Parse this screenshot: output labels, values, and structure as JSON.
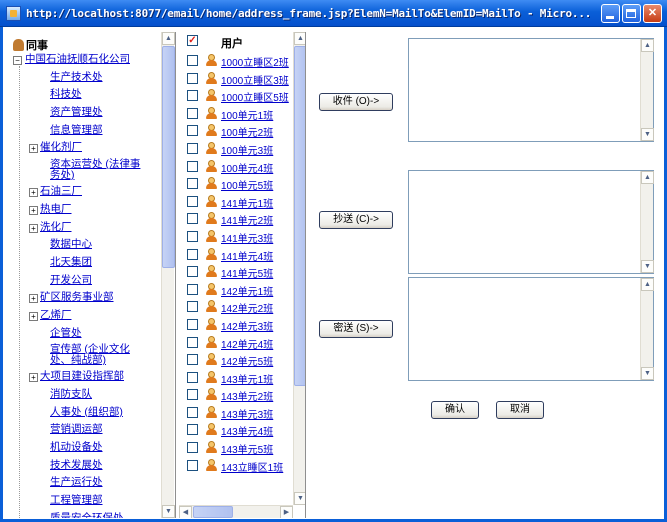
{
  "window": {
    "title": "http://localhost:8077/email/home/address_frame.jsp?ElemN=MailTo&ElemID=MailTo - Micro..."
  },
  "tree": {
    "header": "同事",
    "root": "中国石油抚顺石化公司",
    "items": [
      {
        "label": "生产技术处",
        "expandable": false
      },
      {
        "label": "科技处",
        "expandable": false
      },
      {
        "label": "资产管理处",
        "expandable": false
      },
      {
        "label": "信息管理部",
        "expandable": false
      },
      {
        "label": "催化剂厂",
        "expandable": true
      },
      {
        "label": "资本运营处 (法律事务处)",
        "expandable": false
      },
      {
        "label": "石油三厂",
        "expandable": true
      },
      {
        "label": "热电厂",
        "expandable": true
      },
      {
        "label": "洗化厂",
        "expandable": true
      },
      {
        "label": "数据中心",
        "expandable": false
      },
      {
        "label": "北天集团",
        "expandable": false
      },
      {
        "label": "开发公司",
        "expandable": false
      },
      {
        "label": "矿区服务事业部",
        "expandable": true
      },
      {
        "label": "乙烯厂",
        "expandable": true
      },
      {
        "label": "企管处",
        "expandable": false
      },
      {
        "label": "宣传部 (企业文化处、纯战部)",
        "expandable": false
      },
      {
        "label": "大项目建设指挥部",
        "expandable": true
      },
      {
        "label": "消防支队",
        "expandable": false
      },
      {
        "label": "人事处 (组织部)",
        "expandable": false
      },
      {
        "label": "营销调运部",
        "expandable": false
      },
      {
        "label": "机动设备处",
        "expandable": false
      },
      {
        "label": "技术发展处",
        "expandable": false
      },
      {
        "label": "生产运行处",
        "expandable": false
      },
      {
        "label": "工程管理部",
        "expandable": false
      },
      {
        "label": "质量安全环保处",
        "expandable": false
      }
    ]
  },
  "users": {
    "header": "用户",
    "items": [
      "1000立睡区2班",
      "1000立睡区3班",
      "1000立睡区5班",
      "100单元1班",
      "100单元2班",
      "100单元3班",
      "100单元4班",
      "100单元5班",
      "141单元1班",
      "141单元2班",
      "141单元3班",
      "141单元4班",
      "141单元5班",
      "142单元1班",
      "142单元2班",
      "142单元3班",
      "142单元4班",
      "142单元5班",
      "143单元1班",
      "143单元2班",
      "143单元3班",
      "143单元4班",
      "143单元5班",
      "143立睡区1班"
    ]
  },
  "recipients": {
    "to_label": "收件 (O)->",
    "cc_label": "抄送 (C)->",
    "bcc_label": "密送 (S)->",
    "to_value": "",
    "cc_value": "",
    "bcc_value": ""
  },
  "actions": {
    "ok_label": "确认",
    "cancel_label": "取消"
  },
  "colors": {
    "titlebar": "#0a5fd8",
    "link": "#0000cc",
    "close_button": "#c63d15"
  }
}
